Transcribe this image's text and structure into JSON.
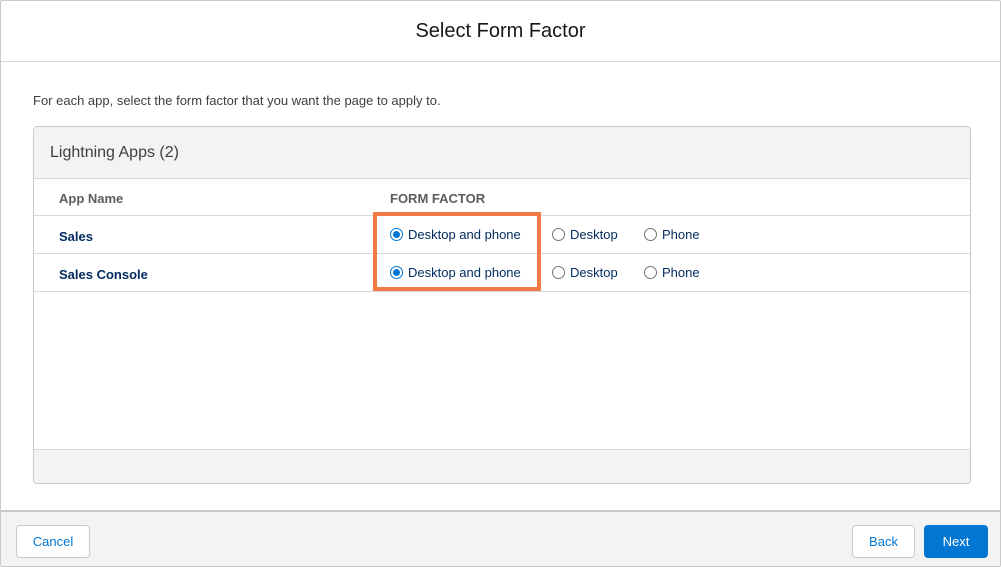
{
  "modal": {
    "title": "Select Form Factor",
    "instructions": "For each app, select the form factor that you want the page to apply to."
  },
  "card": {
    "title": "Lightning Apps (2)",
    "columns": [
      "App Name",
      "FORM FACTOR"
    ],
    "rows": [
      {
        "app": "Sales",
        "options": [
          "Desktop and phone",
          "Desktop",
          "Phone"
        ],
        "selected": "Desktop and phone"
      },
      {
        "app": "Sales Console",
        "options": [
          "Desktop and phone",
          "Desktop",
          "Phone"
        ],
        "selected": "Desktop and phone"
      }
    ]
  },
  "footer": {
    "cancel_label": "Cancel",
    "back_label": "Back",
    "next_label": "Next"
  },
  "colors": {
    "accent": "#0176d3",
    "highlight": "#f47a45",
    "app_name": "#032d60"
  }
}
